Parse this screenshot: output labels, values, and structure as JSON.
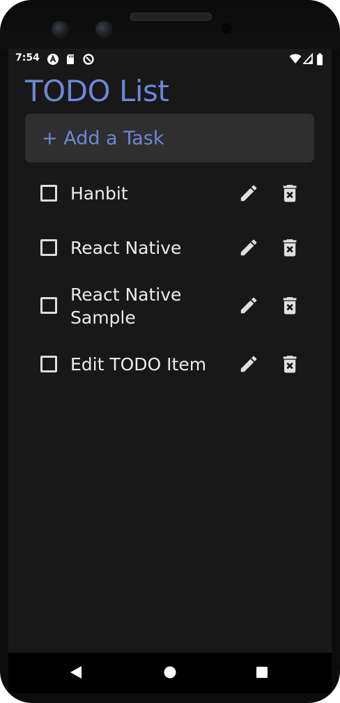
{
  "status_bar": {
    "time": "7:54"
  },
  "app": {
    "title": "TODO List",
    "title_color": "#6f86d6"
  },
  "add_task": {
    "placeholder": "+ Add a Task"
  },
  "tasks": [
    {
      "label": "Hanbit",
      "checked": false
    },
    {
      "label": "React Native",
      "checked": false
    },
    {
      "label": "React Native Sample",
      "checked": false
    },
    {
      "label": "Edit TODO Item",
      "checked": false
    }
  ],
  "icons": {
    "checkbox": "checkbox-outline-icon",
    "edit": "pencil-icon",
    "delete": "trash-x-icon"
  },
  "navigation": {
    "back": "back-triangle-icon",
    "home": "home-circle-icon",
    "recents": "recents-square-icon"
  }
}
